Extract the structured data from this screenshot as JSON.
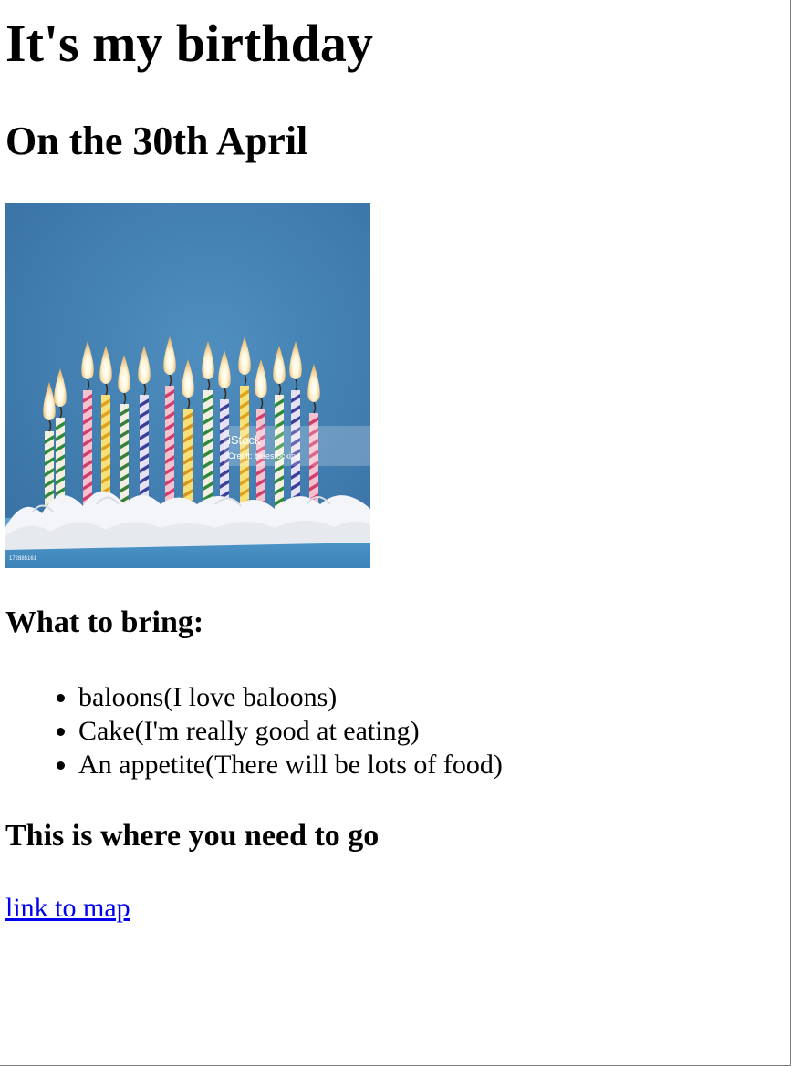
{
  "page": {
    "title": "It's my birthday",
    "subtitle": "On the 30th April"
  },
  "image": {
    "watermark_brand": "iStock",
    "watermark_credit": "Credit: bluestocking",
    "stock_id": "172885161",
    "colors": {
      "background": "#3f7eb0",
      "frosting": "#f1f3f6",
      "cake": "#4f97c9"
    }
  },
  "bring": {
    "heading": "What to bring:",
    "items": [
      "baloons(I love baloons)",
      "Cake(I'm really good at eating)",
      "An appetite(There will be lots of food)"
    ]
  },
  "location": {
    "heading": "This is where you need to go",
    "link_text": "link to map"
  },
  "colors": {
    "link": "#0000ee",
    "text": "#000000"
  }
}
